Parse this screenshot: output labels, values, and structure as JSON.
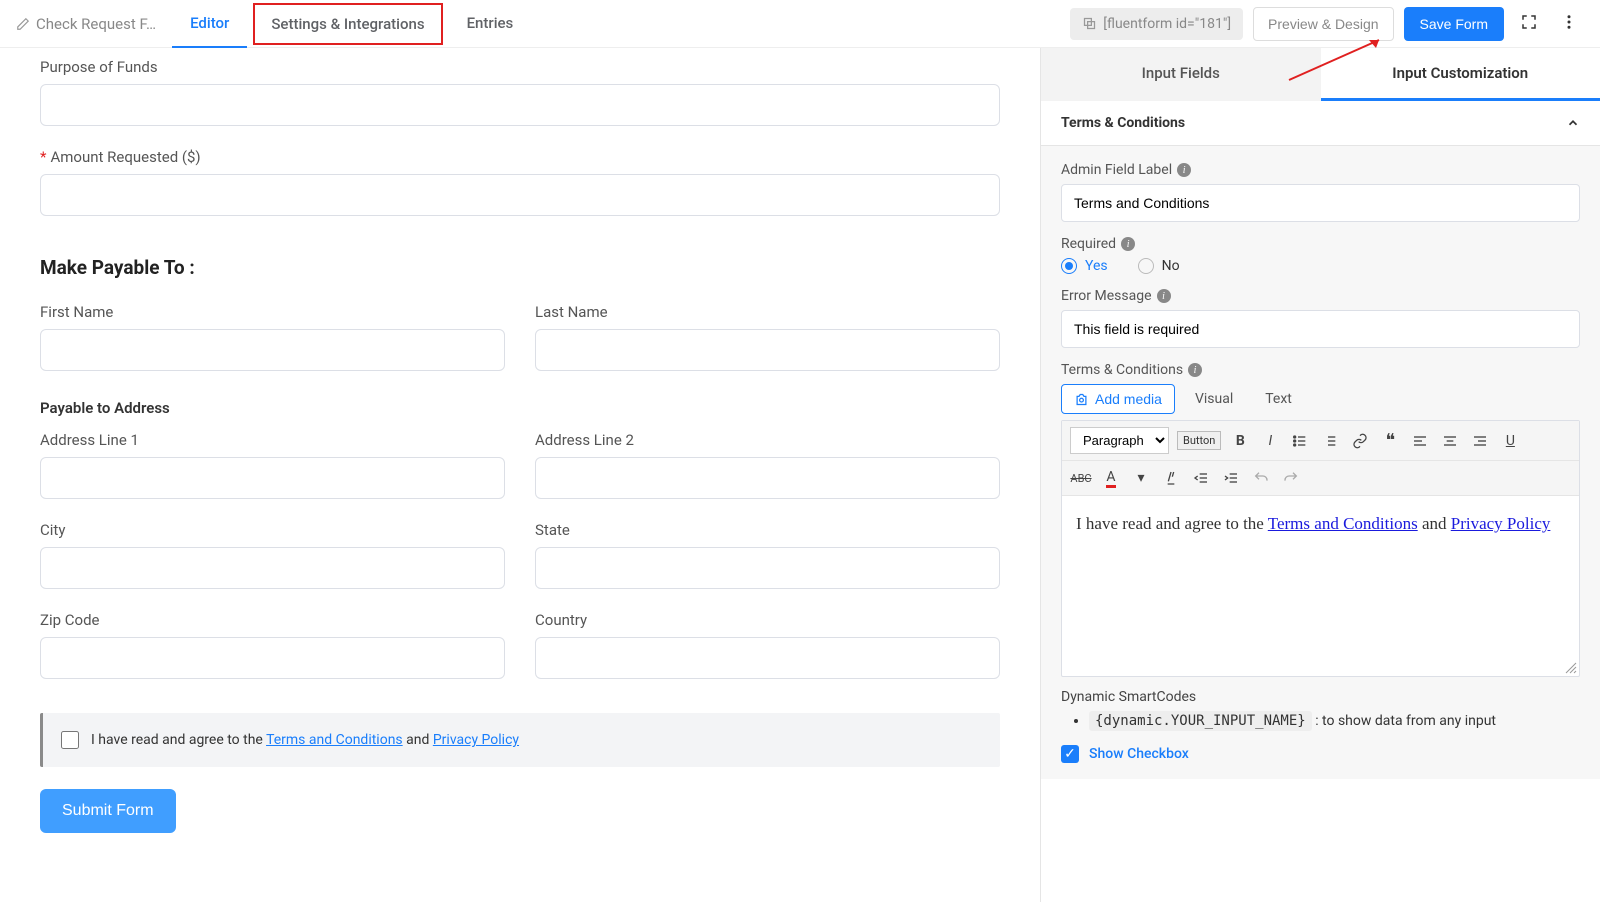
{
  "header": {
    "formTitle": "Check Request F…",
    "tabs": {
      "editor": "Editor",
      "settings": "Settings & Integrations",
      "entries": "Entries"
    },
    "shortcode": "[fluentform id=\"181\"]",
    "previewBtn": "Preview & Design",
    "saveBtn": "Save Form"
  },
  "canvas": {
    "purposeLabel": "Purpose of Funds",
    "amountLabel": "Amount Requested ($)",
    "payableSection": "Make Payable To :",
    "firstName": "First Name",
    "lastName": "Last Name",
    "payableAddress": "Payable to Address",
    "addr1": "Address Line 1",
    "addr2": "Address Line 2",
    "city": "City",
    "state": "State",
    "zip": "Zip Code",
    "country": "Country",
    "terms": {
      "prefix": "I have read and agree to the ",
      "link1": "Terms and Conditions",
      "mid": " and ",
      "link2": "Privacy Policy"
    },
    "submit": "Submit Form"
  },
  "sideTabs": {
    "fields": "Input Fields",
    "custom": "Input Customization"
  },
  "panel": {
    "title": "Terms & Conditions",
    "adminLabel": "Admin Field Label",
    "adminValue": "Terms and Conditions",
    "requiredLabel": "Required",
    "yes": "Yes",
    "no": "No",
    "errorLabel": "Error Message",
    "errorValue": "This field is required",
    "tcLabel": "Terms & Conditions",
    "addMedia": "Add media",
    "visual": "Visual",
    "text": "Text",
    "formatSelect": "Paragraph",
    "buttonBtn": "Button",
    "rteBody": {
      "prefix": "I have read and agree to the ",
      "link1": "Terms and Conditions",
      "mid": " and ",
      "link2": "Privacy Policy"
    },
    "smartLabel": "Dynamic SmartCodes",
    "smartCode": "{dynamic.YOUR_INPUT_NAME}",
    "smartDesc": " : to show data from any input",
    "showCheckbox": "Show Checkbox"
  }
}
